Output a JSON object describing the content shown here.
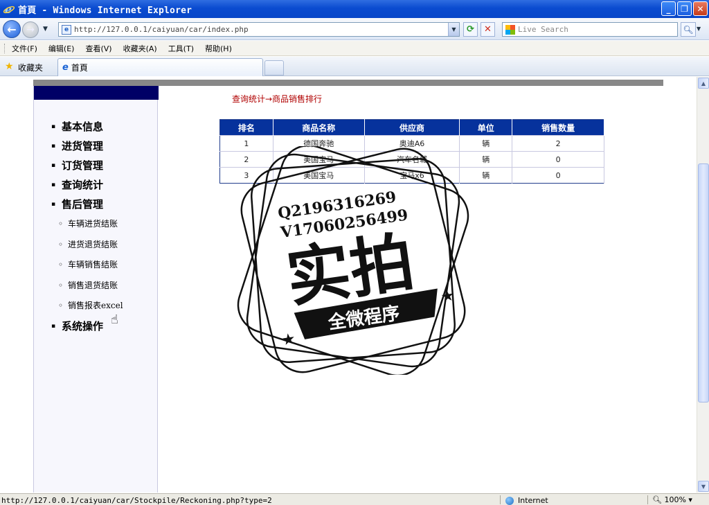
{
  "window": {
    "title": "首頁 - Windows Internet Explorer"
  },
  "toolbar": {
    "url": "http://127.0.0.1/caiyuan/car/index.php",
    "search_placeholder": "Live Search"
  },
  "menu": {
    "items": [
      "文件(F)",
      "编辑(E)",
      "查看(V)",
      "收藏夹(A)",
      "工具(T)",
      "帮助(H)"
    ]
  },
  "favorites": {
    "label": "收藏夹",
    "tab_title": "首頁"
  },
  "sidebar": {
    "items": [
      {
        "label": "基本信息"
      },
      {
        "label": "进货管理"
      },
      {
        "label": "订货管理"
      },
      {
        "label": "查询统计"
      },
      {
        "label": "售后管理"
      }
    ],
    "subitems": [
      "车辆进货结账",
      "进货退货结账",
      "车辆销售结账",
      "销售退货结账",
      "销售报表excel"
    ],
    "last_item": "系统操作"
  },
  "main": {
    "breadcrumb": "查询统计→商品销售排行",
    "table": {
      "columns": [
        "排名",
        "商品名称",
        "供应商",
        "单位",
        "销售数量"
      ],
      "rows": [
        [
          "1",
          "德国奔驰",
          "奥迪A6",
          "辆",
          "2"
        ],
        [
          "2",
          "美国宝马",
          "汽车名城",
          "辆",
          "0"
        ],
        [
          "3",
          "美国宝马",
          "宝马x6",
          "辆",
          "0"
        ]
      ]
    }
  },
  "watermark": {
    "line1": "Q2196316269",
    "line2": "V17060256499",
    "main": "实拍",
    "banner": "全微程序"
  },
  "statusbar": {
    "url": "http://127.0.0.1/caiyuan/car/Stockpile/Reckoning.php?type=2",
    "zone": "Internet",
    "zoom": "100%"
  }
}
